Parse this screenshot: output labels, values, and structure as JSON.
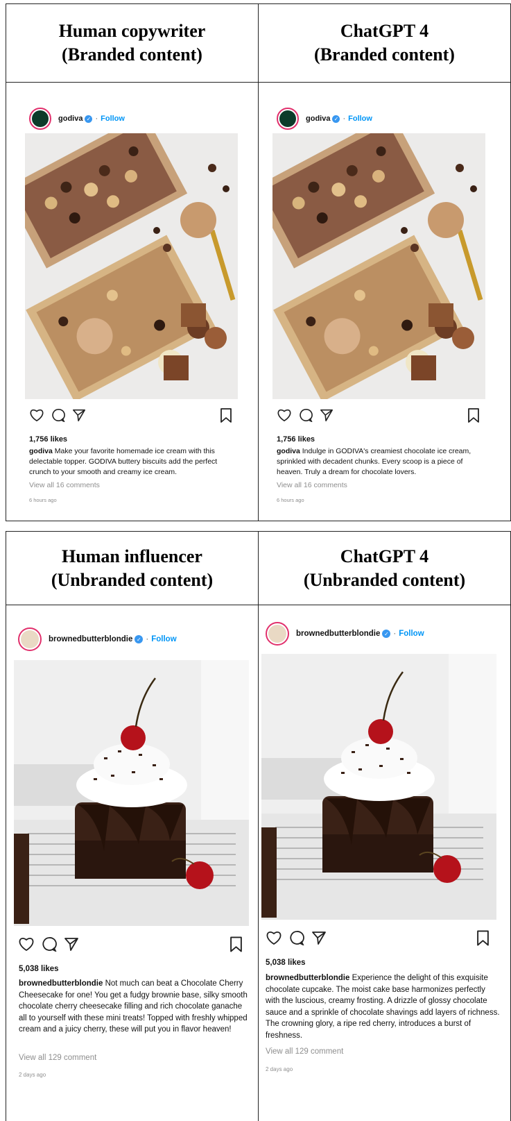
{
  "top": {
    "left": {
      "header_line1": "Human copywriter",
      "header_line2": "(Branded content)",
      "username": "godiva",
      "follow": "Follow",
      "likes": "1,756 likes",
      "caption_user": "godiva",
      "caption_text": "Make your favorite homemade ice cream with this delectable topper. GODIVA buttery biscuits add the perfect crunch to your smooth and creamy ice cream.",
      "comments": "View all 16 comments",
      "time": "6 hours ago"
    },
    "right": {
      "header_line1": "ChatGPT 4",
      "header_line2": "(Branded content)",
      "username": "godiva",
      "follow": "Follow",
      "likes": "1,756 likes",
      "caption_user": "godiva",
      "caption_text": "Indulge in GODIVA's creamiest chocolate ice cream, sprinkled with decadent chunks. Every scoop is a piece of heaven. Truly a dream for chocolate lovers.",
      "comments": "View all 16 comments",
      "time": "6 hours ago"
    }
  },
  "bottom": {
    "left": {
      "header_line1": "Human influencer",
      "header_line2": "(Unbranded content)",
      "username": "brownedbutterblondie",
      "follow": "Follow",
      "likes": "5,038 likes",
      "caption_user": "brownedbutterblondie",
      "caption_text": "Not much can beat a Chocolate Cherry Cheesecake for one! You get a fudgy brownie base, silky smooth chocolate cherry cheesecake filling and rich chocolate ganache all to yourself with these mini treats! Topped with freshly whipped cream and a juicy cherry, these will put you in flavor heaven!",
      "comments": "View all 129 comment",
      "time": "2 days ago"
    },
    "right": {
      "header_line1": "ChatGPT 4",
      "header_line2": "(Unbranded content)",
      "username": "brownedbutterblondie",
      "follow": "Follow",
      "likes": "5,038 likes",
      "caption_user": "brownedbutterblondie",
      "caption_text": "Experience the delight of this exquisite chocolate cupcake. The moist cake base harmonizes perfectly with the luscious, creamy frosting. A drizzle of glossy chocolate sauce and a sprinkle of chocolate shavings add layers of richness. The crowning glory, a ripe red cherry, introduces a burst of freshness.",
      "comments": "View all 129 comment",
      "time": "2 days ago"
    }
  },
  "colors": {
    "follow": "#0095f6",
    "verified": "#3897f0",
    "meta_gray": "#8e8e8e",
    "border": "#222222"
  },
  "icons": [
    "heart-icon",
    "comment-icon",
    "share-icon",
    "bookmark-icon",
    "verified-icon"
  ]
}
